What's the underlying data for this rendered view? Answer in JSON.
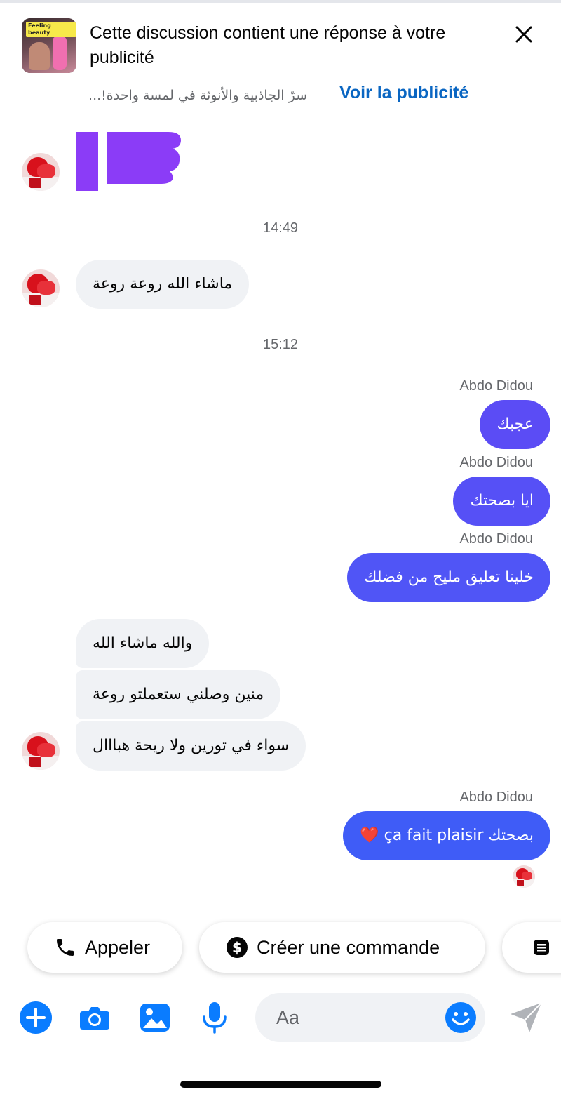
{
  "ad_banner": {
    "thumbnail_caption": "Feeling beauty",
    "title": "Cette discussion contient une réponse à votre publicité",
    "subtitle": "سرّ الجاذبية والأنوثة في لمسة واحدة!...",
    "link_label": "Voir la publicité"
  },
  "messages": {
    "time_1": "14:49",
    "incoming_1": "ماشاء الله روعة روعة",
    "time_2": "15:12",
    "outgoing_1": {
      "sender": "Abdo Didou",
      "text": "عجبك"
    },
    "outgoing_2": {
      "sender": "Abdo Didou",
      "text": "ايا بصحتك"
    },
    "outgoing_3": {
      "sender": "Abdo Didou",
      "text": "خلينا تعليق مليح من فضلك"
    },
    "incoming_2": "والله ماشاء الله",
    "incoming_3": "منين وصلني ستعملتو روعة",
    "incoming_4": "سواء في تورين ولا ريحة هبااال",
    "outgoing_4": {
      "sender": "Abdo Didou",
      "text": "بصحتك ça fait plaisir ❤️"
    }
  },
  "quick_actions": {
    "call_label": "Appeler",
    "order_label": "Créer une commande"
  },
  "composer": {
    "placeholder": "Aa"
  },
  "colors": {
    "accent_blue": "#0a66c2",
    "messenger_blue": "#0a7cff",
    "out_bubble_purple": "#5b4cf5",
    "out_bubble_blue": "#3f5cf7",
    "in_bubble": "#f0f2f5"
  },
  "icons": [
    "close-icon",
    "phone-icon",
    "dollar-icon",
    "note-icon",
    "plus-icon",
    "camera-icon",
    "gallery-icon",
    "microphone-icon",
    "emoji-icon",
    "send-icon"
  ]
}
